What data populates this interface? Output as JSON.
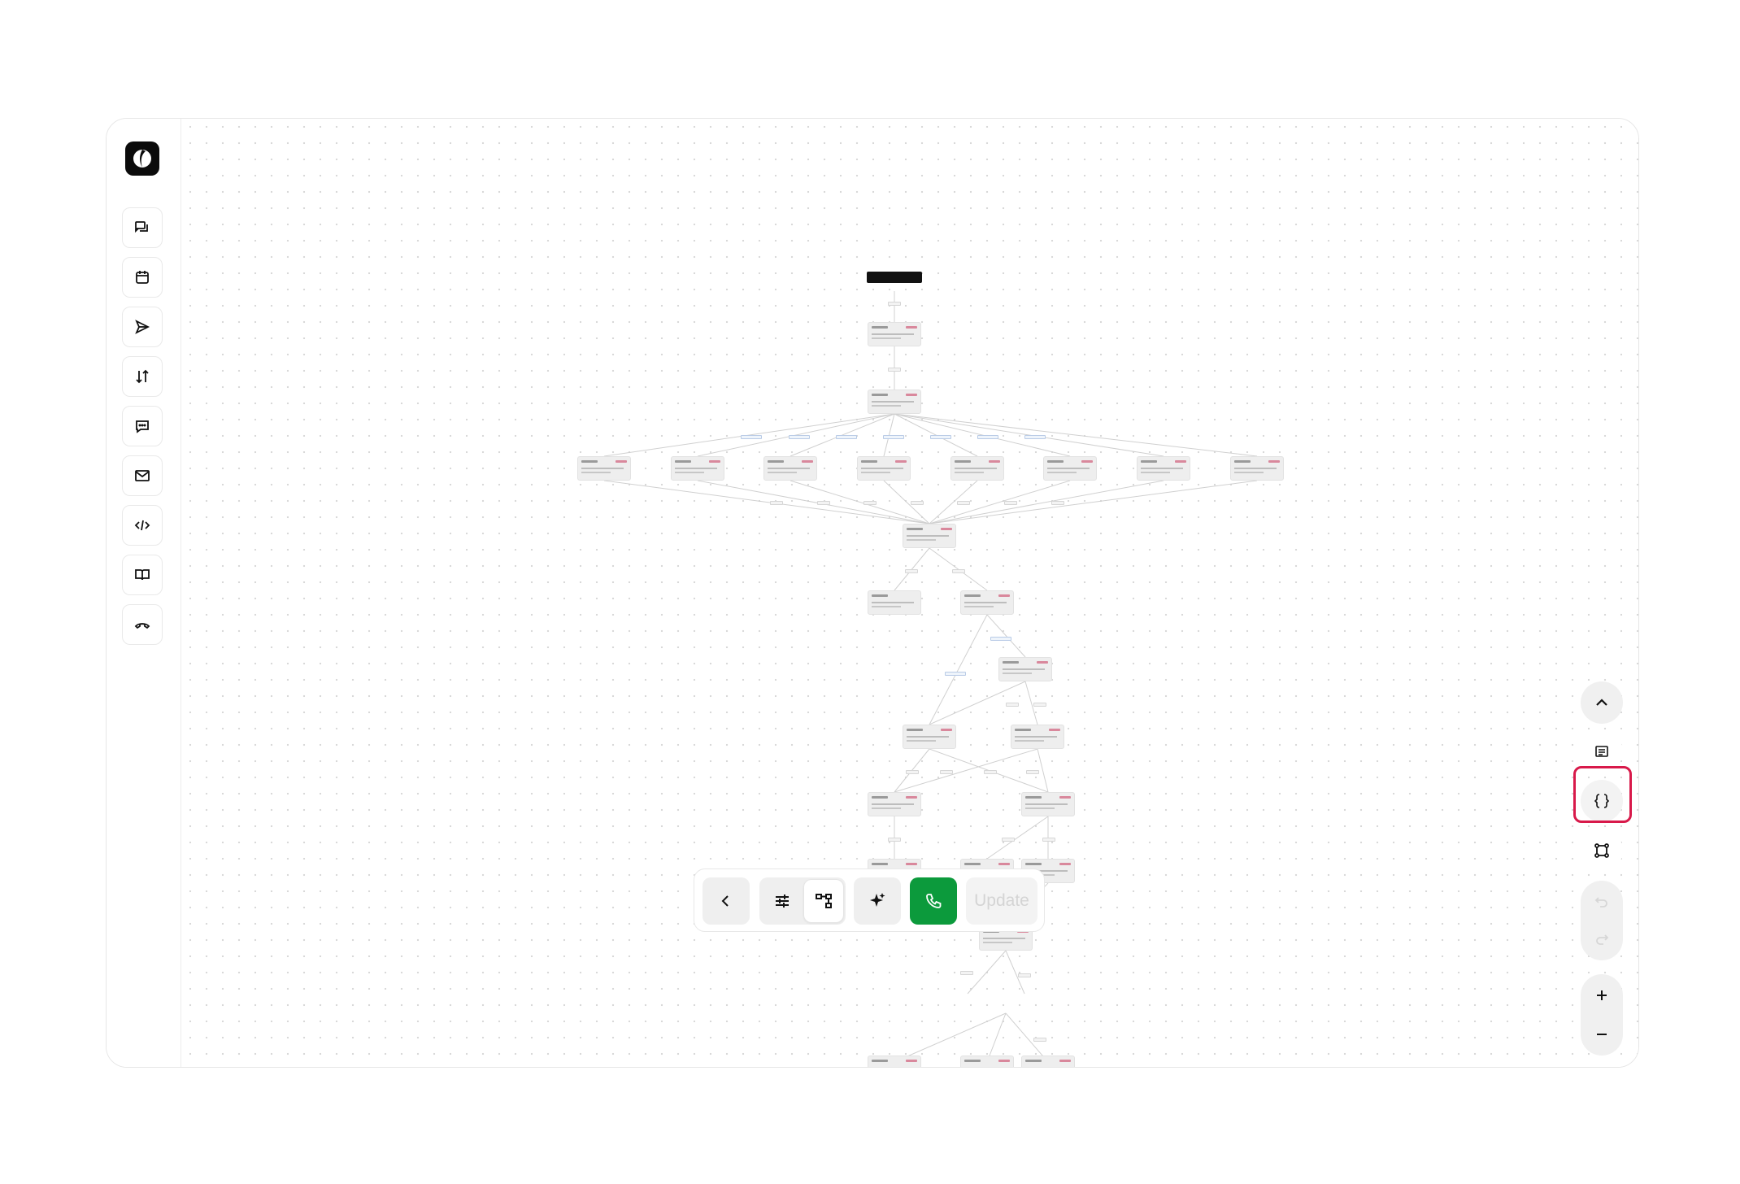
{
  "app": {
    "logo_icon": "brand-logo-icon"
  },
  "sidebar": {
    "items": [
      {
        "name": "conversations",
        "icon": "chat-bubbles-icon"
      },
      {
        "name": "calendar",
        "icon": "calendar-icon"
      },
      {
        "name": "campaigns",
        "icon": "send-icon"
      },
      {
        "name": "transfers",
        "icon": "arrows-swap-icon"
      },
      {
        "name": "messages",
        "icon": "message-icon"
      },
      {
        "name": "email",
        "icon": "mail-icon"
      },
      {
        "name": "developer",
        "icon": "code-icon"
      },
      {
        "name": "knowledge",
        "icon": "book-icon"
      },
      {
        "name": "calls",
        "icon": "phone-hangup-icon"
      }
    ]
  },
  "toolbar": {
    "update_label": "Update",
    "colors": {
      "call_button": "#0c9a3c"
    }
  },
  "right_tools": {
    "icons": [
      "chevron-up-icon",
      "list-icon",
      "code-braces-icon",
      "flow-diagram-icon",
      "undo-icon",
      "redo-icon",
      "plus-icon",
      "minus-icon"
    ],
    "highlight_color": "#d8194a"
  }
}
